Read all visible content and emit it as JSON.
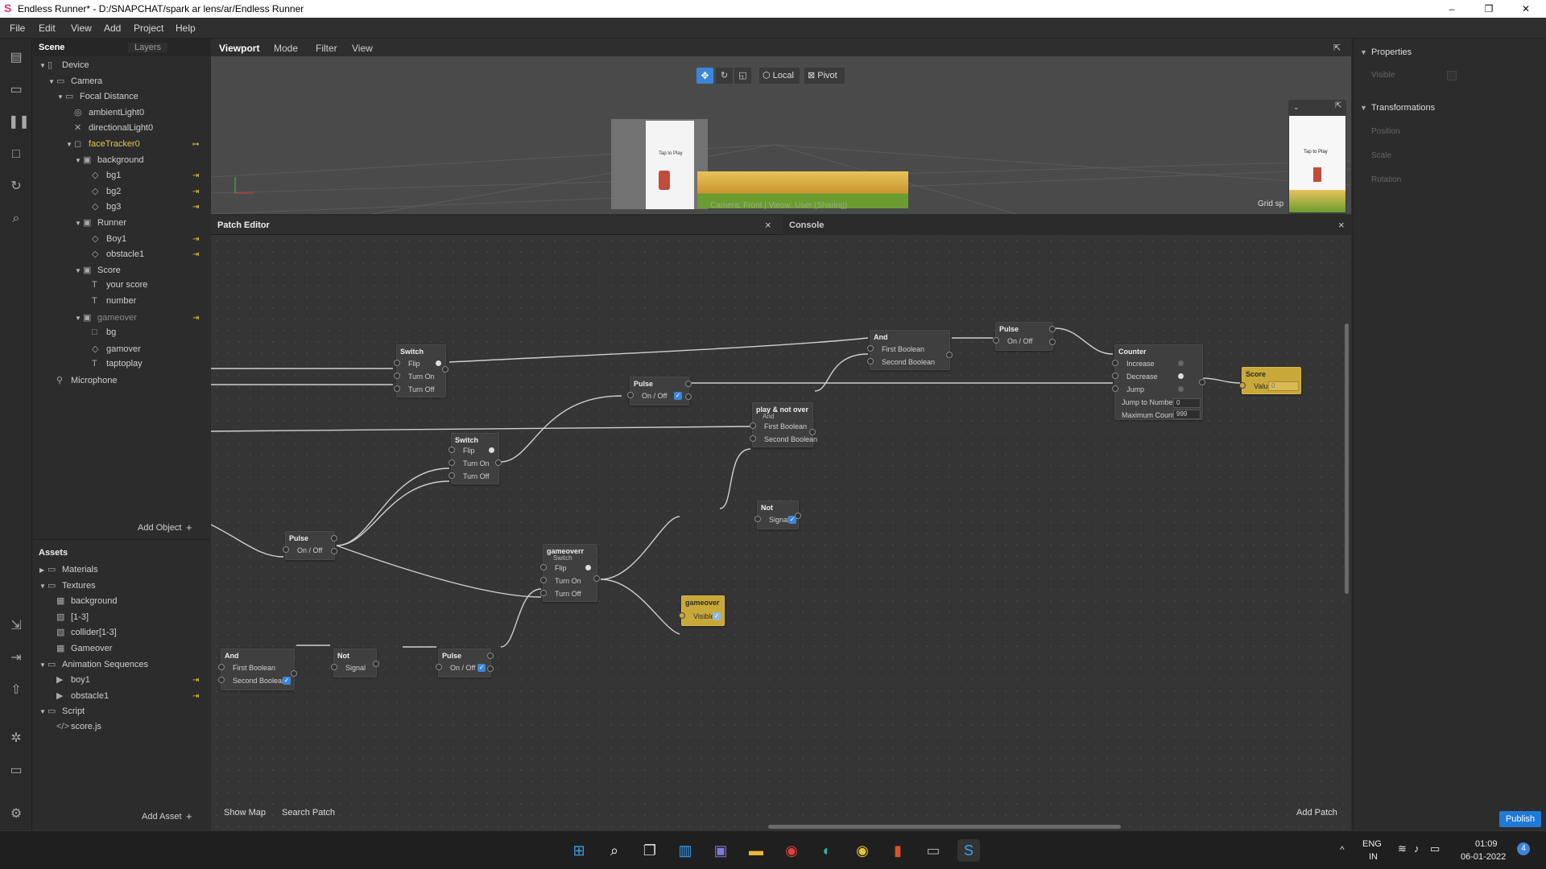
{
  "window": {
    "title": "Endless Runner* - D:/SNAPCHAT/spark ar lens/ar/Endless Runner",
    "minimize": "–",
    "maximize": "❐",
    "close": "✕"
  },
  "menu": [
    "File",
    "Edit",
    "View",
    "Add",
    "Project",
    "Help"
  ],
  "left_toolbar": [
    "layout-icon",
    "video-icon",
    "pause-icon",
    "square-icon",
    "refresh-icon",
    "search-icon",
    "import-icon",
    "export-icon",
    "upload-icon",
    "bug-icon",
    "screen-icon",
    "settings-icon"
  ],
  "scene_panel": {
    "tab_scene": "Scene",
    "tab_layers": "Layers",
    "items": [
      {
        "label": "Device",
        "icon": "▯",
        "depth": 0,
        "arrow": "▼"
      },
      {
        "label": "Camera",
        "icon": "▭",
        "depth": 1,
        "arrow": "▼"
      },
      {
        "label": "Focal Distance",
        "icon": "▭",
        "depth": 2,
        "arrow": "▼"
      },
      {
        "label": "ambientLight0",
        "icon": "◎",
        "depth": 3,
        "arrow": ""
      },
      {
        "label": "directionalLight0",
        "icon": "✕",
        "depth": 3,
        "arrow": ""
      },
      {
        "label": "faceTracker0",
        "icon": "◻",
        "depth": 3,
        "arrow": "▼",
        "state": "sel",
        "pin": "↦"
      },
      {
        "label": "background",
        "icon": "▣",
        "depth": 4,
        "arrow": "▼"
      },
      {
        "label": "bg1",
        "icon": "◇",
        "depth": 5,
        "arrow": "",
        "pin": "⇥"
      },
      {
        "label": "bg2",
        "icon": "◇",
        "depth": 5,
        "arrow": "",
        "pin": "⇥"
      },
      {
        "label": "bg3",
        "icon": "◇",
        "depth": 5,
        "arrow": "",
        "pin": "⇥"
      },
      {
        "label": "Runner",
        "icon": "▣",
        "depth": 4,
        "arrow": "▼"
      },
      {
        "label": "Boy1",
        "icon": "◇",
        "depth": 5,
        "arrow": "",
        "pin": "⇥"
      },
      {
        "label": "obstacle1",
        "icon": "◇",
        "depth": 5,
        "arrow": "",
        "pin": "⇥"
      },
      {
        "label": "Score",
        "icon": "▣",
        "depth": 4,
        "arrow": "▼"
      },
      {
        "label": "your score",
        "icon": "T",
        "depth": 5,
        "arrow": ""
      },
      {
        "label": "number",
        "icon": "T",
        "depth": 5,
        "arrow": ""
      },
      {
        "label": "gameover",
        "icon": "▣",
        "depth": 4,
        "arrow": "▼",
        "state": "dim",
        "pin": "⇥"
      },
      {
        "label": "bg",
        "icon": "□",
        "depth": 5,
        "arrow": ""
      },
      {
        "label": "gamover",
        "icon": "◇",
        "depth": 5,
        "arrow": ""
      },
      {
        "label": "taptoplay",
        "icon": "T",
        "depth": 5,
        "arrow": ""
      },
      {
        "label": "Microphone",
        "icon": "⚲",
        "depth": 1,
        "arrow": ""
      }
    ],
    "add_object": "Add Object",
    "plus": "+"
  },
  "assets_panel": {
    "title": "Assets",
    "items": [
      {
        "label": "Materials",
        "icon": "▭",
        "depth": 0,
        "arrow": "▶"
      },
      {
        "label": "Textures",
        "icon": "▭",
        "depth": 0,
        "arrow": "▼"
      },
      {
        "label": "background",
        "icon": "▦",
        "depth": 1,
        "arrow": ""
      },
      {
        "label": "[1-3]",
        "icon": "▧",
        "depth": 1,
        "arrow": ""
      },
      {
        "label": "collider[1-3]",
        "icon": "▧",
        "depth": 1,
        "arrow": ""
      },
      {
        "label": "Gameover",
        "icon": "▦",
        "depth": 1,
        "arrow": ""
      },
      {
        "label": "Animation Sequences",
        "icon": "▭",
        "depth": 0,
        "arrow": "▼"
      },
      {
        "label": "boy1",
        "icon": "▶",
        "depth": 1,
        "arrow": "",
        "pin": "⇥"
      },
      {
        "label": "obstacle1",
        "icon": "▶",
        "depth": 1,
        "arrow": "",
        "pin": "⇥"
      },
      {
        "label": "Script",
        "icon": "▭",
        "depth": 0,
        "arrow": "▼"
      },
      {
        "label": "score.js",
        "icon": "</>",
        "depth": 1,
        "arrow": ""
      }
    ],
    "add_asset": "Add Asset",
    "plus": "+"
  },
  "viewport": {
    "tabs": [
      "Viewport",
      "Mode",
      "Filter",
      "View"
    ],
    "tools": {
      "local": "Local",
      "pivot": "Pivot"
    },
    "camera_label": "Camera: Front | Vieuw: User (Sharing)",
    "grid_label": "Grid sp",
    "preview_text": "Tap to Play",
    "game_text": "Tap to Play"
  },
  "patch_editor": {
    "tab": "Patch Editor",
    "console_tab": "Console",
    "close": "×",
    "show_map": "Show Map",
    "search_patch": "Search Patch",
    "add_patch": "Add Patch",
    "nodes": {
      "switch1": {
        "title": "Switch",
        "ports": [
          "Flip",
          "Turn On",
          "Turn Off"
        ]
      },
      "and1": {
        "title": "And",
        "ports": [
          "First Boolean",
          "Second Boolean"
        ]
      },
      "pulse1": {
        "title": "Pulse",
        "ports": [
          "On / Off"
        ]
      },
      "counter": {
        "title": "Counter",
        "ports": [
          "Increase",
          "Decrease",
          "Jump",
          "Jump to Number",
          "Maximum Count"
        ],
        "jump_value": "0",
        "max_value": "999"
      },
      "score": {
        "title": "Score",
        "port": "Value",
        "value": "0"
      },
      "pulse2": {
        "title": "Pulse",
        "ports": [
          "On / Off"
        ]
      },
      "playnotover": {
        "title": "play & not over",
        "subtitle": "And",
        "ports": [
          "First Boolean",
          "Second Boolean"
        ]
      },
      "switch2": {
        "title": "Switch",
        "ports": [
          "Flip",
          "Turn On",
          "Turn Off"
        ]
      },
      "pulse3": {
        "title": "Pulse",
        "ports": [
          "On / Off"
        ]
      },
      "not1": {
        "title": "Not",
        "ports": [
          "Signal"
        ]
      },
      "gameoverr": {
        "title": "gameoverr",
        "subtitle": "Switch",
        "ports": [
          "Flip",
          "Turn On",
          "Turn Off"
        ]
      },
      "gameover": {
        "title": "gameover",
        "port": "Visible"
      },
      "and2": {
        "title": "And",
        "ports": [
          "First Boolean",
          "Second Boolean"
        ]
      },
      "not2": {
        "title": "Not",
        "ports": [
          "Signal"
        ]
      },
      "pulse4": {
        "title": "Pulse",
        "ports": [
          "On / Off"
        ]
      }
    }
  },
  "properties_panel": {
    "properties": "Properties",
    "visible": "Visible",
    "transformations": "Transformations",
    "position": "Position",
    "scale": "Scale",
    "rotation": "Rotation",
    "publish": "Publish"
  },
  "taskbar": {
    "lang1": "ENG",
    "lang2": "IN",
    "time": "01:09",
    "date": "06-01-2022",
    "notif": "4"
  },
  "colors": {
    "accent": "#3b86d9",
    "yellow_node": "#c9a83a",
    "selected": "#e6c64d"
  }
}
